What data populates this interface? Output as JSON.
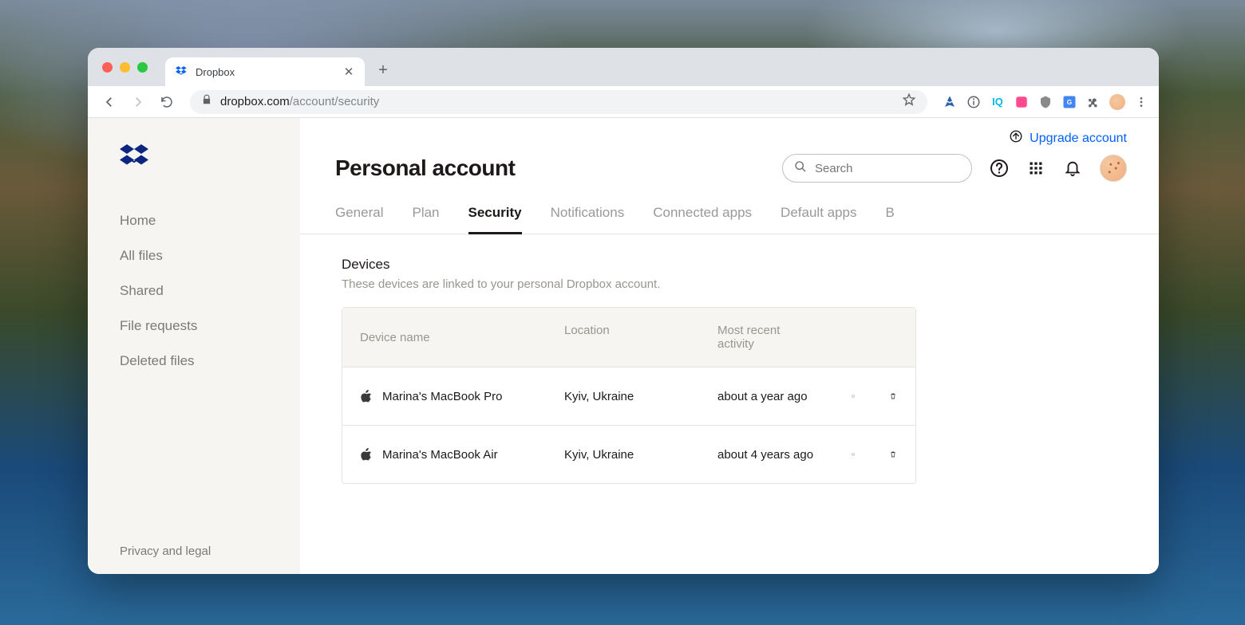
{
  "browser": {
    "tab_title": "Dropbox",
    "url_host": "dropbox.com",
    "url_path": "/account/security"
  },
  "sidebar": {
    "items": [
      {
        "label": "Home"
      },
      {
        "label": "All files"
      },
      {
        "label": "Shared"
      },
      {
        "label": "File requests"
      },
      {
        "label": "Deleted files"
      }
    ],
    "footer": "Privacy and legal"
  },
  "header": {
    "upgrade_label": "Upgrade account",
    "page_title": "Personal account",
    "search_placeholder": "Search"
  },
  "tabs": [
    {
      "label": "General",
      "active": false
    },
    {
      "label": "Plan",
      "active": false
    },
    {
      "label": "Security",
      "active": true
    },
    {
      "label": "Notifications",
      "active": false
    },
    {
      "label": "Connected apps",
      "active": false
    },
    {
      "label": "Default apps",
      "active": false
    },
    {
      "label": "B",
      "active": false
    }
  ],
  "devices_section": {
    "title": "Devices",
    "description": "These devices are linked to your personal Dropbox account.",
    "columns": {
      "name": "Device name",
      "location": "Location",
      "activity": "Most recent activity"
    },
    "rows": [
      {
        "name": "Marina's MacBook Pro",
        "location": "Kyiv, Ukraine",
        "activity": "about a year ago",
        "os": "apple"
      },
      {
        "name": "Marina's MacBook Air",
        "location": "Kyiv, Ukraine",
        "activity": "about 4 years ago",
        "os": "apple"
      }
    ]
  }
}
